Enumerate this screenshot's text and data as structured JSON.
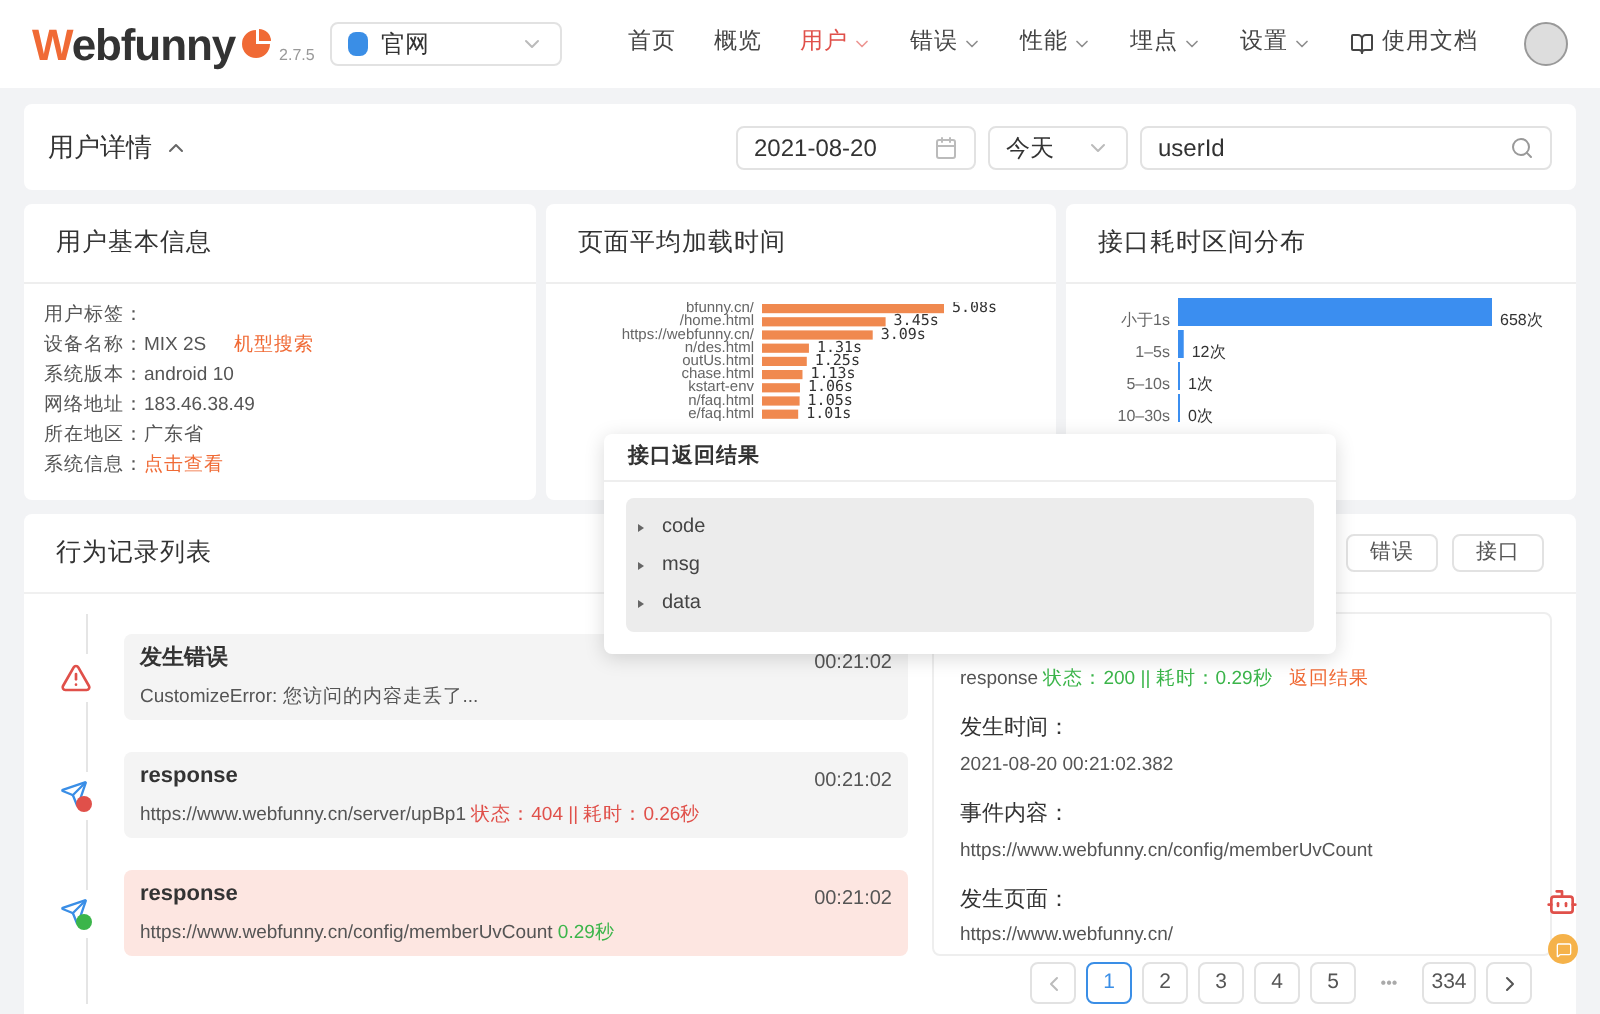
{
  "header": {
    "logo_text": "Webfunny",
    "version": "2.7.5",
    "project": "官网",
    "nav": [
      {
        "label": "首页",
        "kind": "link",
        "selected": false
      },
      {
        "label": "概览",
        "kind": "link",
        "selected": false
      },
      {
        "label": "用户",
        "kind": "menu",
        "selected": true
      },
      {
        "label": "错误",
        "kind": "menu",
        "selected": false
      },
      {
        "label": "性能",
        "kind": "menu",
        "selected": false
      },
      {
        "label": "埋点",
        "kind": "menu",
        "selected": false
      },
      {
        "label": "设置",
        "kind": "menu",
        "selected": false
      },
      {
        "label": "使用文档",
        "kind": "docs",
        "selected": false
      }
    ]
  },
  "filter_bar": {
    "title": "用户详情",
    "date": "2021-08-20",
    "range": "今天",
    "search": "userId"
  },
  "user_info": {
    "title": "用户基本信息",
    "fields": [
      {
        "label": "用户标签："
      },
      {
        "label": "设备名称：",
        "value": "MIX 2S",
        "link": "机型搜索"
      },
      {
        "label": "系统版本：",
        "value": "android 10"
      },
      {
        "label": "网络地址：",
        "value": "183.46.38.49"
      },
      {
        "label": "所在地区：",
        "value": "广东省"
      },
      {
        "label": "系统信息：",
        "link": "点击查看"
      }
    ]
  },
  "page_load": {
    "title": "页面平均加载时间",
    "chart_data": {
      "type": "bar",
      "orientation": "horizontal",
      "categories": [
        "bfunny.cn/",
        "/home.html",
        "https://webfunny.cn/",
        "n/des.html",
        "outUs.html",
        "chase.html",
        "kstart-env",
        "n/faq.html",
        "e/faq.html"
      ],
      "values": [
        5.08,
        3.45,
        3.09,
        1.31,
        1.25,
        1.13,
        1.06,
        1.05,
        1.01
      ],
      "value_labels": [
        "5.08s",
        "3.45s",
        "3.09s",
        "1.31s",
        "1.25s",
        "1.13s",
        "1.06s",
        "1.05s",
        "1.01s"
      ]
    }
  },
  "api_time": {
    "title": "接口耗时区间分布",
    "chart_data": {
      "type": "bar",
      "orientation": "horizontal",
      "categories": [
        "小于1s",
        "1–5s",
        "5–10s",
        "10–30s"
      ],
      "values": [
        658,
        12,
        1,
        0
      ],
      "value_labels": [
        "658次",
        "12次",
        "1次",
        "0次"
      ]
    }
  },
  "behavior": {
    "title": "行为记录列表",
    "filters": [
      "错误",
      "接口"
    ],
    "records": [
      {
        "kind": "error",
        "title": "发生错误",
        "text": "CustomizeError: 您访问的内容走丢了...",
        "time": "00:21:02",
        "selected": false
      },
      {
        "kind": "response_fail",
        "title": "response",
        "text": "https://www.webfunny.cn/server/upBp1",
        "status": "状态：404 || 耗时：0.26秒",
        "time": "00:21:02",
        "selected": false
      },
      {
        "kind": "response_ok",
        "title": "response",
        "text": "https://www.webfunny.cn/config/memberUvCount",
        "status": "0.29秒",
        "time": "00:21:02",
        "selected": true
      }
    ],
    "detail": {
      "event_type": "response",
      "status": "状态：200 || 耗时：0.29秒",
      "result_link": "返回结果",
      "sections": [
        {
          "label": "发生时间：",
          "value": "2021-08-20 00:21:02.382"
        },
        {
          "label": "事件内容：",
          "value": "https://www.webfunny.cn/config/memberUvCount"
        },
        {
          "label": "发生页面：",
          "value": "https://www.webfunny.cn/"
        }
      ]
    },
    "pagination": {
      "pages": [
        {
          "label": "1",
          "selected": true
        },
        {
          "label": "2",
          "selected": false
        },
        {
          "label": "3",
          "selected": false
        },
        {
          "label": "4",
          "selected": false
        },
        {
          "label": "5",
          "selected": false
        }
      ],
      "ellipsis": "•••",
      "last": "334"
    }
  },
  "popup": {
    "title": "接口返回结果",
    "keys": [
      "code",
      "msg",
      "data"
    ]
  }
}
